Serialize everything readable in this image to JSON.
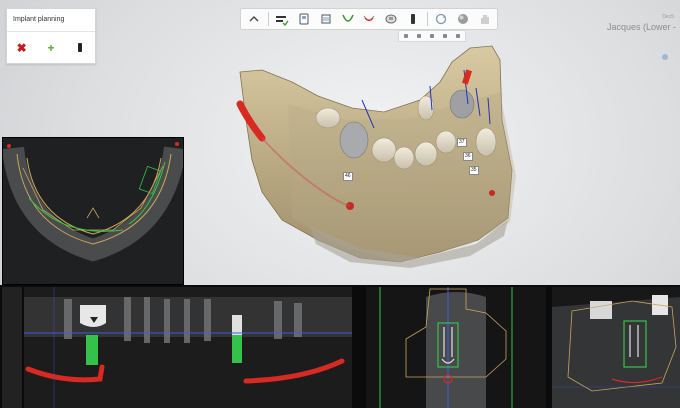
{
  "panel": {
    "title": "Implant planning",
    "buttons": [
      {
        "name": "delete",
        "glyph": "✖"
      },
      {
        "name": "add",
        "glyph": "+"
      },
      {
        "name": "implant"
      }
    ]
  },
  "toolbar": {
    "icons": [
      "chevron-up-icon",
      "implant-check-icon",
      "scan-icon",
      "tooth-crown-icon",
      "jaw-arch-icon",
      "nerve-icon",
      "tooth-view-icon",
      "implant-icon",
      "rotate-icon",
      "sphere-icon",
      "hand-icon"
    ]
  },
  "patient": {
    "name": "Jacques (Lower - ",
    "sub": "Dec5"
  },
  "tooth_labels": [
    "46",
    "37",
    "36",
    "35"
  ],
  "colors": {
    "nerve": "#d82a20",
    "implant_green": "#35c24a",
    "contour": "#c9a55c",
    "cross_line": "#3f5be0"
  }
}
